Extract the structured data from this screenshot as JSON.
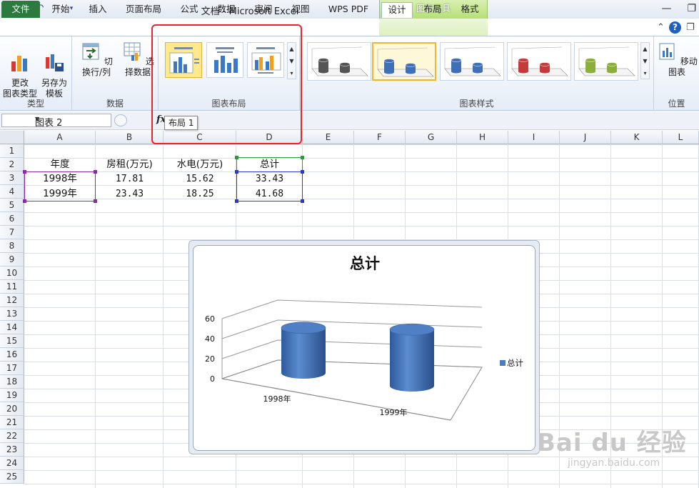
{
  "window": {
    "title": "文档 - Microsoft Excel",
    "context_tab_header": "图表工具"
  },
  "tabs": [
    {
      "label": "文件"
    },
    {
      "label": "开始"
    },
    {
      "label": "插入"
    },
    {
      "label": "页面布局"
    },
    {
      "label": "公式"
    },
    {
      "label": "数据"
    },
    {
      "label": "审阅"
    },
    {
      "label": "视图"
    },
    {
      "label": "WPS PDF"
    },
    {
      "label": "设计",
      "active": true
    },
    {
      "label": "布局"
    },
    {
      "label": "格式"
    }
  ],
  "ribbon": {
    "groups": {
      "type": {
        "label": "类型",
        "change_type": "更改\n图表类型",
        "save_template": "另存为\n模板"
      },
      "data": {
        "label": "数据",
        "switch_row_col": "切换行/列",
        "select_data": "选择数据"
      },
      "layout": {
        "label": "图表布局"
      },
      "styles": {
        "label": "图表样式"
      },
      "location": {
        "label": "位置",
        "move_chart": "移动图表"
      }
    },
    "style_colors": [
      "#555555",
      "#3e6fb7",
      "#3e6fb7",
      "#c63a3a",
      "#8ab03a"
    ]
  },
  "formula_bar": {
    "name_box": "图表 2",
    "fx": "fx"
  },
  "tooltip": "布局 1",
  "columns": [
    "A",
    "B",
    "C",
    "D",
    "E",
    "F",
    "G",
    "H",
    "I",
    "J",
    "K",
    "L"
  ],
  "rows": [
    "1",
    "2",
    "3",
    "4",
    "5",
    "6",
    "7",
    "8",
    "9",
    "10",
    "11",
    "12",
    "13",
    "14",
    "15",
    "16",
    "17",
    "18",
    "19",
    "20",
    "21",
    "22",
    "23",
    "24",
    "25"
  ],
  "table": {
    "headers": [
      "年度",
      "房租(万元)",
      "水电(万元)",
      "总计"
    ],
    "data": [
      [
        "1998年",
        "17.81",
        "15.62",
        "33.43"
      ],
      [
        "1999年",
        "23.43",
        "18.25",
        "41.68"
      ]
    ]
  },
  "chart_data": {
    "type": "bar",
    "style": "3d-cylinder",
    "title": "总计",
    "categories": [
      "1998年",
      "1999年"
    ],
    "series": [
      {
        "name": "总计",
        "values": [
          33.43,
          41.68
        ],
        "color": "#4a7cc2"
      }
    ],
    "ylim": [
      0,
      60
    ],
    "yticks": [
      "0",
      "20",
      "40",
      "60"
    ],
    "legend": "right",
    "grid": true
  },
  "watermark": {
    "main": "Bai du 经验",
    "sub": "jingyan.baidu.com"
  }
}
